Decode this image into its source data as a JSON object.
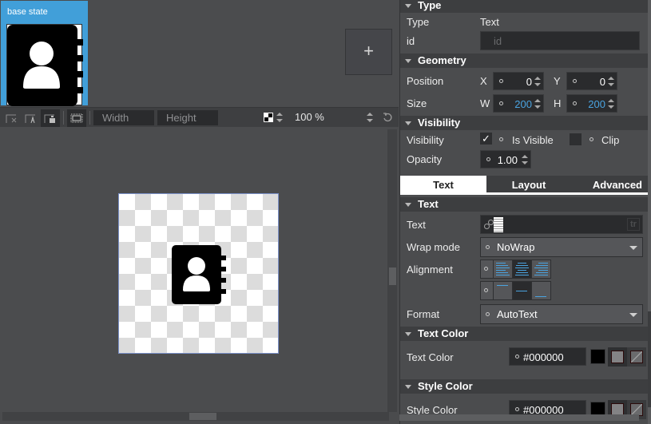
{
  "states": {
    "base_state_label": "base state",
    "add_state_label": "+"
  },
  "toolbar": {
    "width_placeholder": "Width",
    "height_placeholder": "Height",
    "zoom_value": "100 %"
  },
  "properties": {
    "type_section": {
      "title": "Type",
      "type_label": "Type",
      "type_value": "Text",
      "id_label": "id",
      "id_placeholder": "id"
    },
    "geometry_section": {
      "title": "Geometry",
      "position_label": "Position",
      "x_label": "X",
      "x_value": "0",
      "y_label": "Y",
      "y_value": "0",
      "size_label": "Size",
      "w_label": "W",
      "w_value": "200",
      "h_label": "H",
      "h_value": "200"
    },
    "visibility_section": {
      "title": "Visibility",
      "visibility_label": "Visibility",
      "is_visible_label": "Is Visible",
      "is_visible_checked": true,
      "clip_label": "Clip",
      "clip_checked": false,
      "opacity_label": "Opacity",
      "opacity_value": "1.00"
    },
    "tabs": [
      {
        "label": "Text",
        "active": true
      },
      {
        "label": "Layout",
        "active": false
      },
      {
        "label": "Advanced",
        "active": false
      }
    ],
    "text_section": {
      "title": "Text",
      "text_label": "Text",
      "text_value": "",
      "tr_label": "tr",
      "wrap_mode_label": "Wrap mode",
      "wrap_mode_value": "NoWrap",
      "alignment_label": "Alignment",
      "horizontal_alignment": "center",
      "vertical_alignment": "center",
      "format_label": "Format",
      "format_value": "AutoText"
    },
    "text_color_section": {
      "title": "Text Color",
      "label": "Text Color",
      "value": "#000000"
    },
    "style_color_section": {
      "title": "Style Color",
      "label": "Style Color",
      "value": "#000000"
    }
  },
  "colors": {
    "accent": "#419fd9",
    "value_blue": "#4aa3e0",
    "panel_bg": "#4b4c4e",
    "field_bg": "#2a2b2d"
  }
}
